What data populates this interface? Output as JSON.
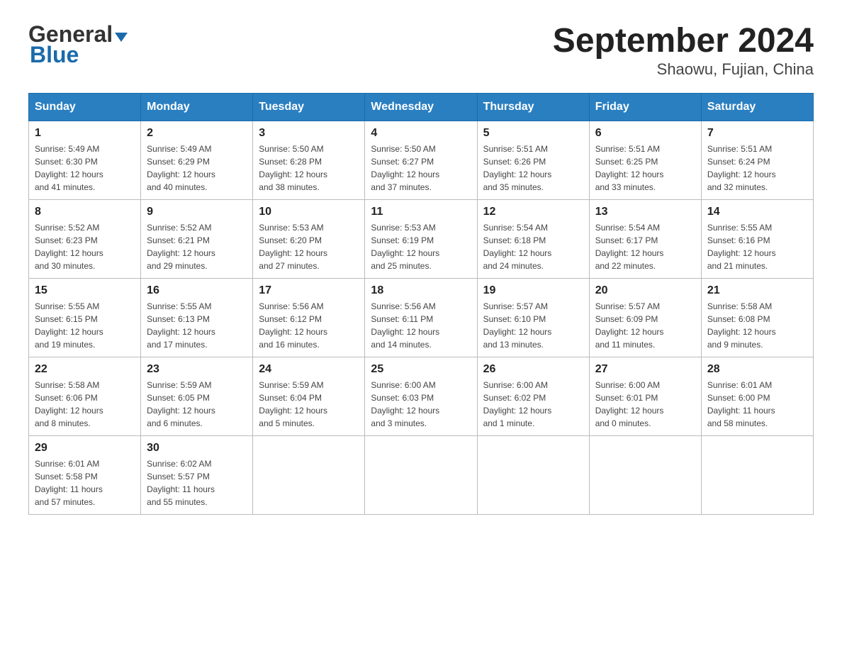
{
  "header": {
    "logo_general": "General",
    "logo_blue": "Blue",
    "title": "September 2024",
    "subtitle": "Shaowu, Fujian, China"
  },
  "weekdays": [
    "Sunday",
    "Monday",
    "Tuesday",
    "Wednesday",
    "Thursday",
    "Friday",
    "Saturday"
  ],
  "weeks": [
    [
      {
        "day": "1",
        "sunrise": "5:49 AM",
        "sunset": "6:30 PM",
        "daylight": "12 hours and 41 minutes."
      },
      {
        "day": "2",
        "sunrise": "5:49 AM",
        "sunset": "6:29 PM",
        "daylight": "12 hours and 40 minutes."
      },
      {
        "day": "3",
        "sunrise": "5:50 AM",
        "sunset": "6:28 PM",
        "daylight": "12 hours and 38 minutes."
      },
      {
        "day": "4",
        "sunrise": "5:50 AM",
        "sunset": "6:27 PM",
        "daylight": "12 hours and 37 minutes."
      },
      {
        "day": "5",
        "sunrise": "5:51 AM",
        "sunset": "6:26 PM",
        "daylight": "12 hours and 35 minutes."
      },
      {
        "day": "6",
        "sunrise": "5:51 AM",
        "sunset": "6:25 PM",
        "daylight": "12 hours and 33 minutes."
      },
      {
        "day": "7",
        "sunrise": "5:51 AM",
        "sunset": "6:24 PM",
        "daylight": "12 hours and 32 minutes."
      }
    ],
    [
      {
        "day": "8",
        "sunrise": "5:52 AM",
        "sunset": "6:23 PM",
        "daylight": "12 hours and 30 minutes."
      },
      {
        "day": "9",
        "sunrise": "5:52 AM",
        "sunset": "6:21 PM",
        "daylight": "12 hours and 29 minutes."
      },
      {
        "day": "10",
        "sunrise": "5:53 AM",
        "sunset": "6:20 PM",
        "daylight": "12 hours and 27 minutes."
      },
      {
        "day": "11",
        "sunrise": "5:53 AM",
        "sunset": "6:19 PM",
        "daylight": "12 hours and 25 minutes."
      },
      {
        "day": "12",
        "sunrise": "5:54 AM",
        "sunset": "6:18 PM",
        "daylight": "12 hours and 24 minutes."
      },
      {
        "day": "13",
        "sunrise": "5:54 AM",
        "sunset": "6:17 PM",
        "daylight": "12 hours and 22 minutes."
      },
      {
        "day": "14",
        "sunrise": "5:55 AM",
        "sunset": "6:16 PM",
        "daylight": "12 hours and 21 minutes."
      }
    ],
    [
      {
        "day": "15",
        "sunrise": "5:55 AM",
        "sunset": "6:15 PM",
        "daylight": "12 hours and 19 minutes."
      },
      {
        "day": "16",
        "sunrise": "5:55 AM",
        "sunset": "6:13 PM",
        "daylight": "12 hours and 17 minutes."
      },
      {
        "day": "17",
        "sunrise": "5:56 AM",
        "sunset": "6:12 PM",
        "daylight": "12 hours and 16 minutes."
      },
      {
        "day": "18",
        "sunrise": "5:56 AM",
        "sunset": "6:11 PM",
        "daylight": "12 hours and 14 minutes."
      },
      {
        "day": "19",
        "sunrise": "5:57 AM",
        "sunset": "6:10 PM",
        "daylight": "12 hours and 13 minutes."
      },
      {
        "day": "20",
        "sunrise": "5:57 AM",
        "sunset": "6:09 PM",
        "daylight": "12 hours and 11 minutes."
      },
      {
        "day": "21",
        "sunrise": "5:58 AM",
        "sunset": "6:08 PM",
        "daylight": "12 hours and 9 minutes."
      }
    ],
    [
      {
        "day": "22",
        "sunrise": "5:58 AM",
        "sunset": "6:06 PM",
        "daylight": "12 hours and 8 minutes."
      },
      {
        "day": "23",
        "sunrise": "5:59 AM",
        "sunset": "6:05 PM",
        "daylight": "12 hours and 6 minutes."
      },
      {
        "day": "24",
        "sunrise": "5:59 AM",
        "sunset": "6:04 PM",
        "daylight": "12 hours and 5 minutes."
      },
      {
        "day": "25",
        "sunrise": "6:00 AM",
        "sunset": "6:03 PM",
        "daylight": "12 hours and 3 minutes."
      },
      {
        "day": "26",
        "sunrise": "6:00 AM",
        "sunset": "6:02 PM",
        "daylight": "12 hours and 1 minute."
      },
      {
        "day": "27",
        "sunrise": "6:00 AM",
        "sunset": "6:01 PM",
        "daylight": "12 hours and 0 minutes."
      },
      {
        "day": "28",
        "sunrise": "6:01 AM",
        "sunset": "6:00 PM",
        "daylight": "11 hours and 58 minutes."
      }
    ],
    [
      {
        "day": "29",
        "sunrise": "6:01 AM",
        "sunset": "5:58 PM",
        "daylight": "11 hours and 57 minutes."
      },
      {
        "day": "30",
        "sunrise": "6:02 AM",
        "sunset": "5:57 PM",
        "daylight": "11 hours and 55 minutes."
      },
      null,
      null,
      null,
      null,
      null
    ]
  ],
  "labels": {
    "sunrise": "Sunrise:",
    "sunset": "Sunset:",
    "daylight": "Daylight:"
  }
}
